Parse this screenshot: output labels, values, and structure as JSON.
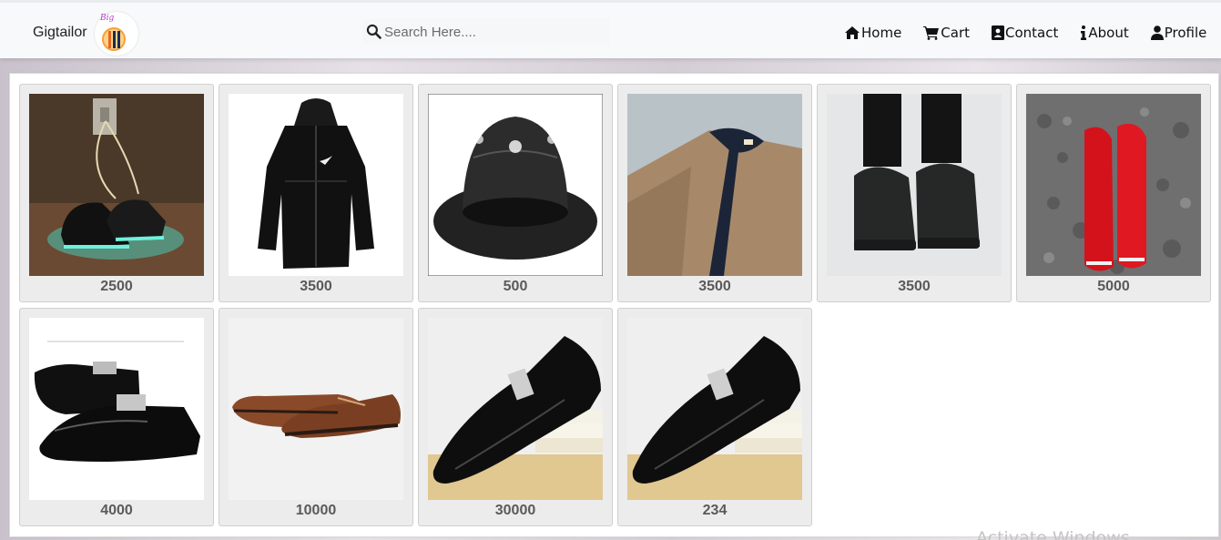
{
  "navbar": {
    "brand": "Gigtailor",
    "logo_text": "Big",
    "search": {
      "placeholder": "Search Here...."
    },
    "links": [
      {
        "label": "Home",
        "icon": "home-icon"
      },
      {
        "label": "Cart",
        "icon": "cart-icon"
      },
      {
        "label": "Contact",
        "icon": "contact-icon"
      },
      {
        "label": "About",
        "icon": "info-icon"
      },
      {
        "label": "Profile",
        "icon": "user-icon"
      }
    ]
  },
  "products": [
    {
      "image": "glowing-sneakers",
      "price": "2500"
    },
    {
      "image": "black-windbreaker-jacket",
      "price": "3500"
    },
    {
      "image": "black-leather-bucket-hat",
      "price": "500"
    },
    {
      "image": "brown-kaftan-outfit",
      "price": "3500"
    },
    {
      "image": "black-knit-sneakers",
      "price": "3500"
    },
    {
      "image": "red-sneakers",
      "price": "5000"
    },
    {
      "image": "black-slip-on-shoes",
      "price": "4000"
    },
    {
      "image": "brown-oxford-shoes",
      "price": "10000"
    },
    {
      "image": "black-loafer-on-books",
      "price": "30000"
    },
    {
      "image": "black-loafer-on-books",
      "price": "234"
    }
  ],
  "watermark": "Activate Windows",
  "colors": {
    "navbar_bg": "#f8f9fa",
    "tile_bg": "#ececec",
    "price_text": "#5a5a5a"
  }
}
